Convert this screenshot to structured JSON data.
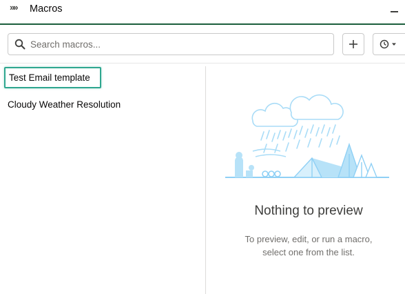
{
  "header": {
    "title": "Macros",
    "expand_icon": "chevron-double-right-icon",
    "minimize_icon": "minimize-icon"
  },
  "toolbar": {
    "search_placeholder": "Search macros...",
    "search_value": "",
    "add_label": "+",
    "history_icon": "clock-icon"
  },
  "macros": [
    {
      "label": "Test Email template",
      "selected": true
    },
    {
      "label": "Cloudy Weather Resolution",
      "selected": false
    }
  ],
  "preview": {
    "empty_title": "Nothing to preview",
    "empty_body": "To preview, edit, or run a macro, select one from the list.",
    "illustration": "rainy-campsite-illustration"
  },
  "colors": {
    "header_underline": "#1b5e3b",
    "selection_border": "#2ea68f",
    "illustration_blue": "#8fd0f5"
  }
}
